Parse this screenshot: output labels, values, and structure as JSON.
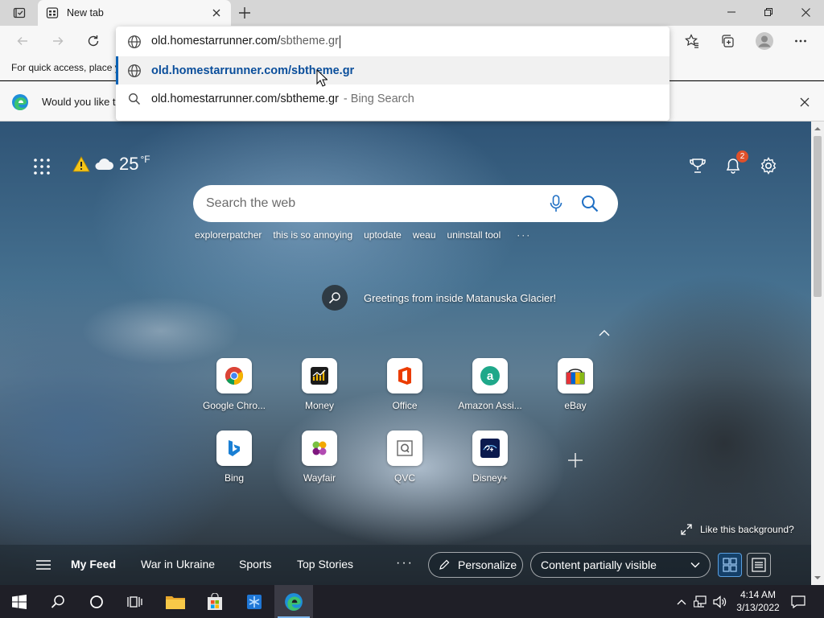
{
  "browser": {
    "tab": {
      "title": "New tab"
    },
    "window_controls": {
      "minimize": "minimize",
      "maximize": "maximize",
      "close": "close"
    }
  },
  "omnibox": {
    "typed_text": "old.homestarrunner.com/",
    "autocomplete_text": "sbtheme.gr",
    "suggestions": [
      {
        "icon": "globe-icon",
        "prefix": "old.homestarrunner.com/",
        "bold": "sbtheme.gr"
      },
      {
        "icon": "search-icon",
        "text": "old.homestarrunner.com/sbtheme.gr",
        "suffix": "- Bing Search"
      }
    ]
  },
  "favbar": {
    "text": "For quick access, place y"
  },
  "notification": {
    "text": "Would you like t"
  },
  "ntp": {
    "weather": {
      "temp": "25",
      "unit": "°F"
    },
    "notifications_count": "2",
    "search": {
      "placeholder": "Search the web"
    },
    "trending": [
      "explorerpatcher",
      "this is so annoying",
      "uptodate",
      "weau",
      "uninstall tool"
    ],
    "trending_more": "···",
    "greeting": "Greetings from inside Matanuska Glacier!",
    "tiles": [
      {
        "label": "Google Chro...",
        "icon": "chrome-icon"
      },
      {
        "label": "Money",
        "icon": "money-icon"
      },
      {
        "label": "Office",
        "icon": "office-icon"
      },
      {
        "label": "Amazon Assi...",
        "icon": "amazon-icon"
      },
      {
        "label": "eBay",
        "icon": "ebay-icon"
      },
      {
        "label": "Bing",
        "icon": "bing-icon"
      },
      {
        "label": "Wayfair",
        "icon": "wayfair-icon"
      },
      {
        "label": "QVC",
        "icon": "qvc-icon"
      },
      {
        "label": "Disney+",
        "icon": "disney-icon"
      }
    ],
    "like_background": "Like this background?",
    "feed": {
      "links": [
        "My Feed",
        "War in Ukraine",
        "Sports",
        "Top Stories"
      ],
      "more": "···",
      "personalize": "Personalize",
      "content_visibility": "Content partially visible"
    }
  },
  "taskbar": {
    "time": "4:14 AM",
    "date": "3/13/2022"
  }
}
